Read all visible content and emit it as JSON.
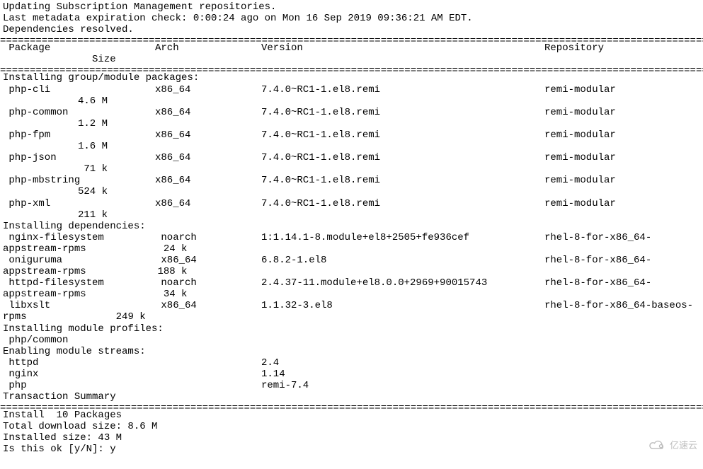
{
  "header": {
    "line1": "Updating Subscription Management repositories.",
    "line2": "Last metadata expiration check: 0:00:24 ago on Mon 16 Sep 2019 09:36:21 AM EDT.",
    "line3": "Dependencies resolved."
  },
  "columns": {
    "package": "Package",
    "arch": "Arch",
    "version": "Version",
    "repository": "Repository",
    "size": "Size"
  },
  "sections": {
    "install_group": "Installing group/module packages:",
    "install_deps": "Installing dependencies:",
    "install_profiles": "Installing module profiles:",
    "enabling_streams": "Enabling module streams:",
    "transaction_summary": "Transaction Summary"
  },
  "group_packages": [
    {
      "name": " php-cli",
      "arch": "x86_64",
      "version": "7.4.0~RC1-1.el8.remi",
      "repo": "remi-modular",
      "size": "4.6 M"
    },
    {
      "name": " php-common",
      "arch": "x86_64",
      "version": "7.4.0~RC1-1.el8.remi",
      "repo": "remi-modular",
      "size": "1.2 M"
    },
    {
      "name": " php-fpm",
      "arch": "x86_64",
      "version": "7.4.0~RC1-1.el8.remi",
      "repo": "remi-modular",
      "size": "1.6 M"
    },
    {
      "name": " php-json",
      "arch": "x86_64",
      "version": "7.4.0~RC1-1.el8.remi",
      "repo": "remi-modular",
      "size": " 71 k"
    },
    {
      "name": " php-mbstring",
      "arch": "x86_64",
      "version": "7.4.0~RC1-1.el8.remi",
      "repo": "remi-modular",
      "size": "524 k"
    },
    {
      "name": " php-xml",
      "arch": "x86_64",
      "version": "7.4.0~RC1-1.el8.remi",
      "repo": "remi-modular",
      "size": "211 k"
    }
  ],
  "dep_packages": [
    {
      "name": " nginx-filesystem",
      "arch": "noarch",
      "version": "1:1.14.1-8.module+el8+2505+fe936cef",
      "repo": "rhel-8-for-x86_64-",
      "repo2": "appstream-rpms",
      "size": "24 k"
    },
    {
      "name": " oniguruma",
      "arch": "x86_64",
      "version": "6.8.2-1.el8",
      "repo": "rhel-8-for-x86_64-",
      "repo2": "appstream-rpms",
      "size": "188 k"
    },
    {
      "name": " httpd-filesystem",
      "arch": "noarch",
      "version": "2.4.37-11.module+el8.0.0+2969+90015743",
      "repo": "rhel-8-for-x86_64-",
      "repo2": "appstream-rpms",
      "size": " 34 k"
    },
    {
      "name": " libxslt",
      "arch": "x86_64",
      "version": "1.1.32-3.el8",
      "repo": "rhel-8-for-x86_64-baseos-",
      "repo2": "rpms",
      "size": "249 k"
    }
  ],
  "profiles": [
    " php/common"
  ],
  "streams": [
    {
      "name": " httpd",
      "version": "2.4"
    },
    {
      "name": " nginx",
      "version": "1.14"
    },
    {
      "name": " php",
      "version": "remi-7.4"
    }
  ],
  "summary": {
    "install": "Install  10 Packages",
    "download": "Total download size: 8.6 M",
    "installed": "Installed size: 43 M",
    "prompt": "Is this ok [y/N]: y"
  },
  "watermark": "亿速云"
}
